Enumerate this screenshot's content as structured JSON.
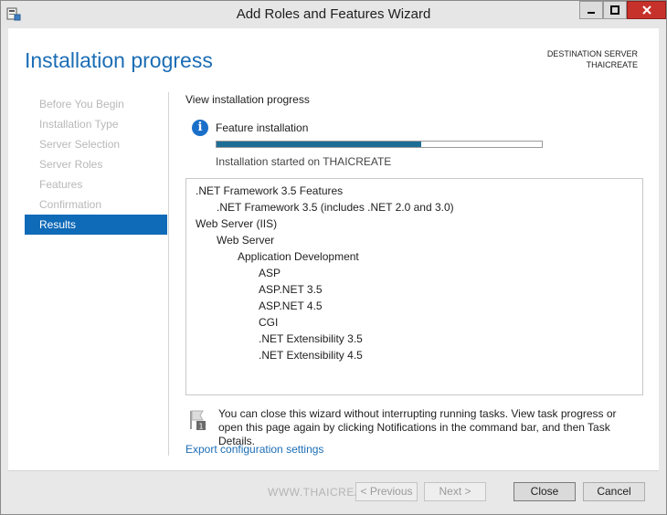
{
  "window": {
    "title": "Add Roles and Features Wizard"
  },
  "page": {
    "title": "Installation progress",
    "destination_label": "DESTINATION SERVER",
    "destination_server": "THAICREATE"
  },
  "nav": {
    "items": [
      {
        "label": "Before You Begin",
        "state": "disabled"
      },
      {
        "label": "Installation Type",
        "state": "disabled"
      },
      {
        "label": "Server Selection",
        "state": "disabled"
      },
      {
        "label": "Server Roles",
        "state": "disabled"
      },
      {
        "label": "Features",
        "state": "disabled"
      },
      {
        "label": "Confirmation",
        "state": "disabled"
      },
      {
        "label": "Results",
        "state": "active"
      }
    ]
  },
  "main": {
    "heading": "View installation progress",
    "feature_installation_label": "Feature installation",
    "progress_fraction": 0.63,
    "started_text": "Installation started on THAICREATE",
    "features": [
      {
        "label": ".NET Framework 3.5 Features",
        "level": 0
      },
      {
        "label": ".NET Framework 3.5 (includes .NET 2.0 and 3.0)",
        "level": 1
      },
      {
        "label": "Web Server (IIS)",
        "level": 0
      },
      {
        "label": "Web Server",
        "level": 1
      },
      {
        "label": "Application Development",
        "level": 2
      },
      {
        "label": "ASP",
        "level": 3
      },
      {
        "label": "ASP.NET 3.5",
        "level": 3
      },
      {
        "label": "ASP.NET 4.5",
        "level": 3
      },
      {
        "label": "CGI",
        "level": 3
      },
      {
        "label": ".NET Extensibility 3.5",
        "level": 3
      },
      {
        "label": ".NET Extensibility 4.5",
        "level": 3
      }
    ],
    "note": "You can close this wizard without interrupting running tasks. View task progress or open this page again by clicking Notifications in the command bar, and then Task Details.",
    "export_link": "Export configuration settings"
  },
  "footer": {
    "watermark": "WWW.THAICREATE.COM",
    "previous_label": "< Previous",
    "next_label": "Next >",
    "close_label": "Close",
    "cancel_label": "Cancel"
  },
  "colors": {
    "accent": "#1b6db5",
    "nav_active": "#0f6ab8",
    "progress": "#1d6e96",
    "close_button": "#c7312b"
  }
}
